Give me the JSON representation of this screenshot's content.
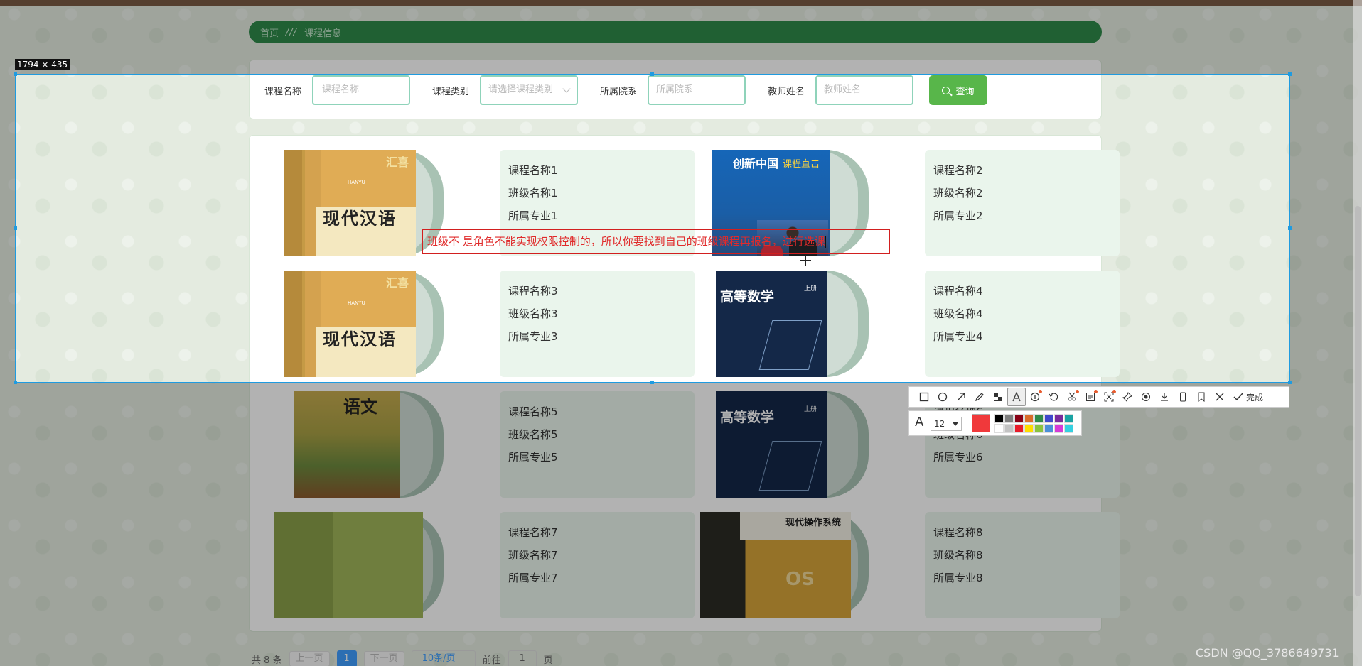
{
  "breadcrumb": {
    "home": "首页",
    "separator": "///",
    "current": "课程信息"
  },
  "search": {
    "course_name_label": "课程名称",
    "course_name_placeholder": "课程名称",
    "category_label": "课程类别",
    "category_placeholder": "请选择课程类别",
    "department_label": "所属院系",
    "department_placeholder": "所属院系",
    "teacher_label": "教师姓名",
    "teacher_placeholder": "教师姓名",
    "query_button": "查询"
  },
  "courses": [
    {
      "name": "课程名称1",
      "class": "班级名称1",
      "major": "所属专业1",
      "cover": "hanyu"
    },
    {
      "name": "课程名称2",
      "class": "班级名称2",
      "major": "所属专业2",
      "cover": "blue"
    },
    {
      "name": "课程名称3",
      "class": "班级名称3",
      "major": "所属专业3",
      "cover": "hanyu"
    },
    {
      "name": "课程名称4",
      "class": "班级名称4",
      "major": "所属专业4",
      "cover": "navy"
    },
    {
      "name": "课程名称5",
      "class": "班级名称5",
      "major": "所属专业5",
      "cover": "yuwen"
    },
    {
      "name": "课程名称6",
      "class": "班级名称6",
      "major": "所属专业6",
      "cover": "navy"
    },
    {
      "name": "课程名称7",
      "class": "班级名称7",
      "major": "所属专业7",
      "cover": "green"
    },
    {
      "name": "课程名称8",
      "class": "班级名称8",
      "major": "所属专业8",
      "cover": "os"
    }
  ],
  "covers": {
    "hanyu_title": "现代汉语",
    "hanyu_tag": "汇喜",
    "hanyu_sub": "HANYU",
    "blue_title": "创新中国",
    "blue_subtitle": "课程直击",
    "navy_title": "高等数学",
    "navy_vol": "上册",
    "yuwen_title": "语文",
    "os_title": "现代操作系统",
    "os_mark": "OS"
  },
  "pagination": {
    "total": "共 8 条",
    "prev": "上一页",
    "current": "1",
    "next": "下一页",
    "page_size": "10条/页",
    "goto_label": "前往",
    "goto_value": "1",
    "page_suffix": "页"
  },
  "overlay": {
    "selection_size": "1794 × 435",
    "annotation_text": "班级不 是角色不能实现权限控制的，所以你要找到自己的班级课程再报名，进行选课",
    "font_size": "12",
    "done_label": "完成",
    "current_color": "#f0393b",
    "palette": [
      "#000000",
      "#7f7f7f",
      "#880015",
      "#d96c2a",
      "#2f8a4a",
      "#3f48cc",
      "#7a2a9c",
      "#1aa3a3",
      "#ffffff",
      "#c3c3c3",
      "#e81c2a",
      "#ffdd00",
      "#8ac43f",
      "#4a90d9",
      "#d63ad6",
      "#35d0e0"
    ]
  },
  "watermark": "CSDN @QQ_3786649731"
}
